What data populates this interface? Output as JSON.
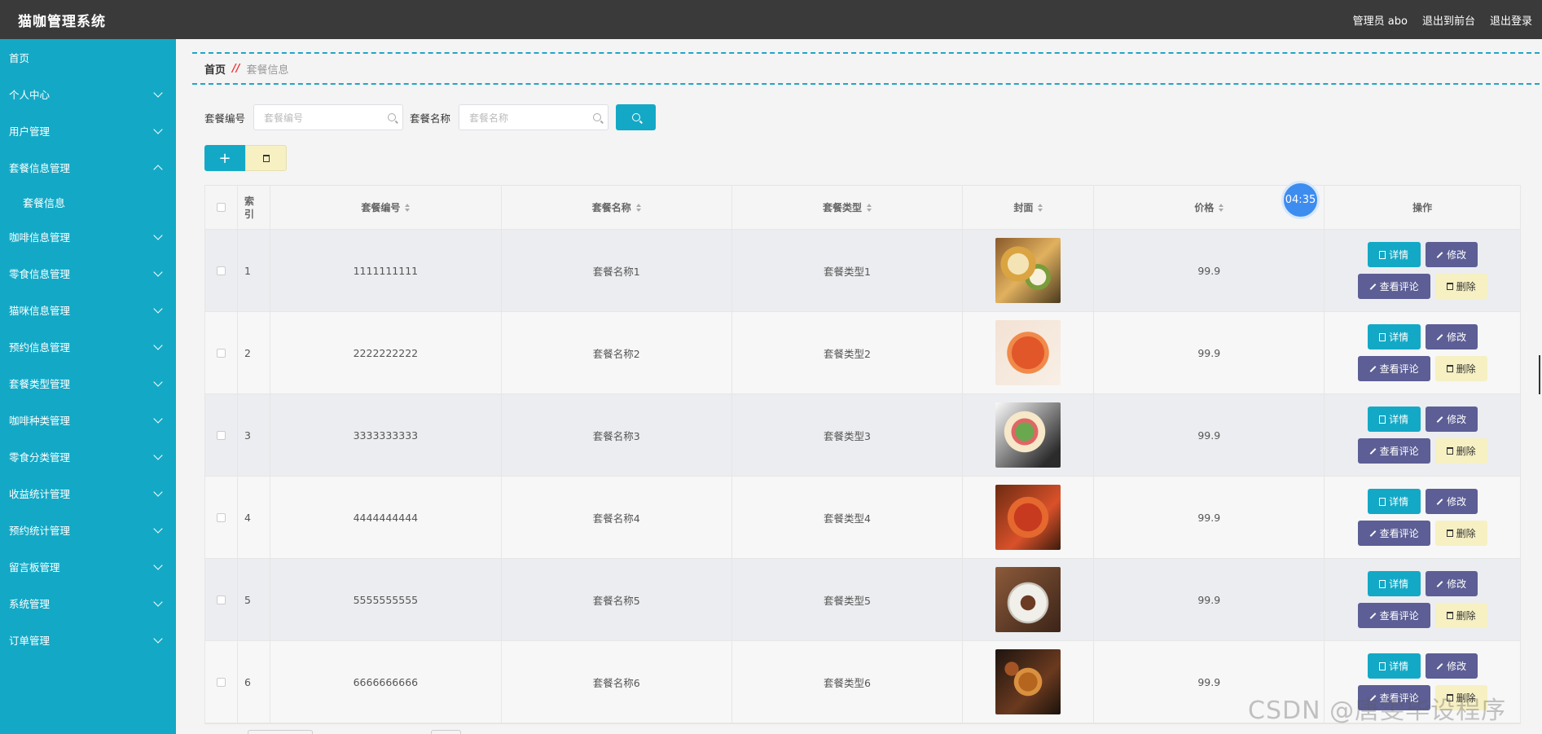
{
  "app": {
    "title": "猫咖管理系统",
    "admin_label": "管理员 abo",
    "to_front": "退出到前台",
    "logout": "退出登录"
  },
  "sidebar": {
    "items": [
      {
        "label": "首页",
        "expandable": false
      },
      {
        "label": "个人中心",
        "expandable": true
      },
      {
        "label": "用户管理",
        "expandable": true
      },
      {
        "label": "套餐信息管理",
        "expandable": true,
        "open": true,
        "children": [
          {
            "label": "套餐信息"
          }
        ]
      },
      {
        "label": "咖啡信息管理",
        "expandable": true
      },
      {
        "label": "零食信息管理",
        "expandable": true
      },
      {
        "label": "猫咪信息管理",
        "expandable": true
      },
      {
        "label": "预约信息管理",
        "expandable": true
      },
      {
        "label": "套餐类型管理",
        "expandable": true
      },
      {
        "label": "咖啡种类管理",
        "expandable": true
      },
      {
        "label": "零食分类管理",
        "expandable": true
      },
      {
        "label": "收益统计管理",
        "expandable": true
      },
      {
        "label": "预约统计管理",
        "expandable": true
      },
      {
        "label": "留言板管理",
        "expandable": true
      },
      {
        "label": "系统管理",
        "expandable": true
      },
      {
        "label": "订单管理",
        "expandable": true
      }
    ]
  },
  "breadcrumb": {
    "home": "首页",
    "sep": "//",
    "current": "套餐信息"
  },
  "search": {
    "code_label": "套餐编号",
    "code_placeholder": "套餐编号",
    "name_label": "套餐名称",
    "name_placeholder": "套餐名称"
  },
  "actions": {
    "add": "+"
  },
  "table": {
    "headers": {
      "index": "索引",
      "code": "套餐编号",
      "name": "套餐名称",
      "type": "套餐类型",
      "cover": "封面",
      "price": "价格",
      "ops": "操作"
    },
    "rows": [
      {
        "index": "1",
        "code": "1111111111",
        "name": "套餐名称1",
        "type": "套餐类型1",
        "price": "99.9"
      },
      {
        "index": "2",
        "code": "2222222222",
        "name": "套餐名称2",
        "type": "套餐类型2",
        "price": "99.9"
      },
      {
        "index": "3",
        "code": "3333333333",
        "name": "套餐名称3",
        "type": "套餐类型3",
        "price": "99.9"
      },
      {
        "index": "4",
        "code": "4444444444",
        "name": "套餐名称4",
        "type": "套餐类型4",
        "price": "99.9"
      },
      {
        "index": "5",
        "code": "5555555555",
        "name": "套餐名称5",
        "type": "套餐类型5",
        "price": "99.9"
      },
      {
        "index": "6",
        "code": "6666666666",
        "name": "套餐名称6",
        "type": "套餐类型6",
        "price": "99.9"
      }
    ],
    "row_actions": {
      "detail": "详情",
      "edit": "修改",
      "review": "查看评论",
      "delete": "删除"
    }
  },
  "timer": "04:35",
  "watermark": "CSDN @唐雯毕设程序",
  "colors": {
    "primary": "#13a9c6",
    "topbar": "#3a3a3a",
    "purple": "#5c5e95",
    "pale_yellow": "#f6f0c3"
  }
}
